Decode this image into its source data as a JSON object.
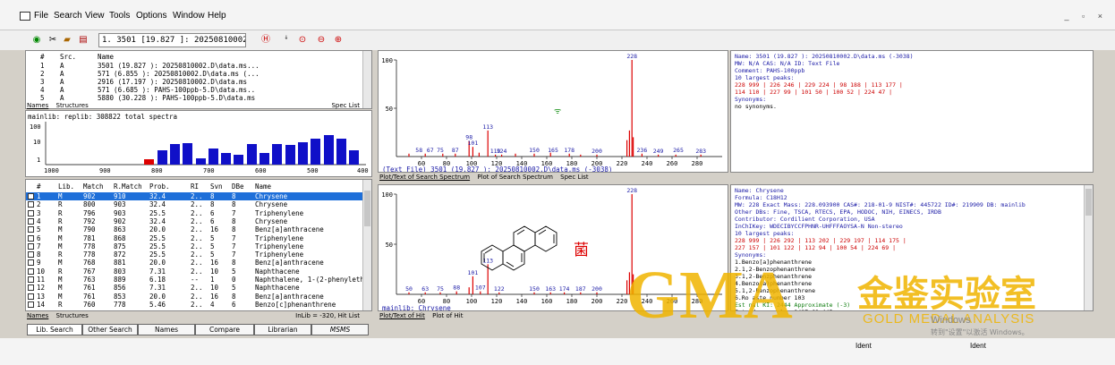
{
  "menu": {
    "items": [
      "File",
      "Search",
      "View",
      "Tools",
      "Options",
      "Window",
      "Help"
    ],
    "window_controls": "_ ▫ ×"
  },
  "toolbar": {
    "hit_select": "1. 3501 [19.827 ]: 20250810002.D\\c"
  },
  "hitlist_top": {
    "headers": [
      "#",
      "Src.",
      "Name"
    ],
    "rows": [
      {
        "n": "1",
        "src": "A",
        "name": "3501 (19.827 ): 20250810002.D\\data.ms..."
      },
      {
        "n": "2",
        "src": "A",
        "name": "571 (6.855 ): 20250810002.D\\data.ms (..."
      },
      {
        "n": "3",
        "src": "A",
        "name": "2916 (17.197 ): 20250810002.D\\data.ms"
      },
      {
        "n": "4",
        "src": "A",
        "name": "571 (6.685 ): PAHS-100ppb-5.D\\data.ms.."
      },
      {
        "n": "5",
        "src": "A",
        "name": "5880 (30.228 ): PAHS-100ppb-5.D\\data.ms"
      }
    ],
    "tabs": [
      "Names",
      "Structures"
    ],
    "label": "Spec List"
  },
  "histogram": {
    "caption": "mainlib: replib: 308822 total spectra",
    "y_ticks": [
      "100",
      "10",
      "1"
    ],
    "x_ticks": [
      "1000",
      "900",
      "800",
      "700",
      "600",
      "500",
      "400"
    ]
  },
  "hitlist": {
    "headers": [
      "#",
      "Lib.",
      "Match",
      "R.Match",
      "Prob.",
      "RI",
      "Svn",
      "DBe",
      "Name"
    ],
    "rows": [
      {
        "n": "1",
        "lib": "M",
        "match": "902",
        "rmatch": "910",
        "prob": "32.4",
        "ri": "2..",
        "svn": "8",
        "dbe": "8",
        "name": "Chrysene"
      },
      {
        "n": "2",
        "lib": "R",
        "match": "800",
        "rmatch": "903",
        "prob": "32.4",
        "ri": "2..",
        "svn": "8",
        "dbe": "8",
        "name": "Chrysene"
      },
      {
        "n": "3",
        "lib": "R",
        "match": "796",
        "rmatch": "903",
        "prob": "25.5",
        "ri": "2..",
        "svn": "6",
        "dbe": "7",
        "name": "Triphenylene"
      },
      {
        "n": "4",
        "lib": "R",
        "match": "792",
        "rmatch": "902",
        "prob": "32.4",
        "ri": "2..",
        "svn": "6",
        "dbe": "8",
        "name": "Chrysene"
      },
      {
        "n": "5",
        "lib": "M",
        "match": "790",
        "rmatch": "863",
        "prob": "20.0",
        "ri": "2..",
        "svn": "16",
        "dbe": "8",
        "name": "Benz[a]anthracene"
      },
      {
        "n": "6",
        "lib": "M",
        "match": "781",
        "rmatch": "868",
        "prob": "25.5",
        "ri": "2..",
        "svn": "5",
        "dbe": "7",
        "name": "Triphenylene"
      },
      {
        "n": "7",
        "lib": "M",
        "match": "778",
        "rmatch": "875",
        "prob": "25.5",
        "ri": "2..",
        "svn": "5",
        "dbe": "7",
        "name": "Triphenylene"
      },
      {
        "n": "8",
        "lib": "R",
        "match": "778",
        "rmatch": "872",
        "prob": "25.5",
        "ri": "2..",
        "svn": "5",
        "dbe": "7",
        "name": "Triphenylene"
      },
      {
        "n": "9",
        "lib": "M",
        "match": "768",
        "rmatch": "881",
        "prob": "20.0",
        "ri": "2..",
        "svn": "16",
        "dbe": "8",
        "name": "Benz[a]anthracene"
      },
      {
        "n": "10",
        "lib": "R",
        "match": "767",
        "rmatch": "803",
        "prob": "7.31",
        "ri": "2..",
        "svn": "10",
        "dbe": "5",
        "name": "Naphthacene"
      },
      {
        "n": "11",
        "lib": "M",
        "match": "763",
        "rmatch": "889",
        "prob": "6.18",
        "ri": "--",
        "svn": "1",
        "dbe": "0",
        "name": "Naphthalene, 1-(2-phenyleth"
      },
      {
        "n": "12",
        "lib": "M",
        "match": "761",
        "rmatch": "856",
        "prob": "7.31",
        "ri": "2..",
        "svn": "10",
        "dbe": "5",
        "name": "Naphthacene"
      },
      {
        "n": "13",
        "lib": "M",
        "match": "761",
        "rmatch": "853",
        "prob": "20.0",
        "ri": "2..",
        "svn": "16",
        "dbe": "8",
        "name": "Benz[a]anthracene"
      },
      {
        "n": "14",
        "lib": "R",
        "match": "760",
        "rmatch": "778",
        "prob": "5.46",
        "ri": "2..",
        "svn": "4",
        "dbe": "6",
        "name": "Benzo[c]phenanthrene"
      }
    ],
    "tabs": [
      "Names",
      "Structures"
    ],
    "label": "InLib = -320, Hit List"
  },
  "bottom_tabs": [
    "Lib. Search",
    "Other Search",
    "Names",
    "Compare",
    "Librarian",
    "MSMS"
  ],
  "spectrum_top": {
    "caption": "(Text File) 3501 (19.827 ): 20250810002.D\\data.ms (-3038)",
    "tabs": [
      "Plot/Text of Search Spectrum",
      "Plot of Search Spectrum",
      "Spec List"
    ]
  },
  "spectrum_bottom": {
    "caption": "mainlib: Chrysene",
    "tabs": [
      "Plot/Text of Hit",
      "Plot of Hit"
    ],
    "compound_label": "菌"
  },
  "chart_data": [
    {
      "type": "bar",
      "title": "(Text File) 3501 (19.827 ): 20250810002.D\\data.ms (-3038)",
      "xlabel": "",
      "ylabel": "",
      "xlim": [
        40,
        300
      ],
      "ylim": [
        0,
        100
      ],
      "x_ticks": [
        "60",
        "80",
        "100",
        "120",
        "140",
        "160",
        "180",
        "200",
        "220",
        "240",
        "260",
        "280"
      ],
      "y_ticks": [
        "100",
        "50"
      ],
      "x": [
        50,
        63,
        77,
        87,
        98,
        101,
        106,
        113,
        119,
        124,
        135,
        150,
        163,
        178,
        187,
        200,
        224,
        226,
        228,
        229,
        236,
        249,
        263,
        283
      ],
      "values": [
        3,
        3,
        3,
        3,
        16,
        10,
        4,
        27,
        2,
        2,
        3,
        3,
        4,
        3,
        2,
        2,
        17,
        27,
        100,
        20,
        3,
        2,
        2,
        2
      ],
      "peak_labels": [
        {
          "x": 58,
          "text": "58"
        },
        {
          "x": 67,
          "text": "67"
        },
        {
          "x": 75,
          "text": "75"
        },
        {
          "x": 87,
          "text": "87"
        },
        {
          "x": 98,
          "text": "98"
        },
        {
          "x": 101,
          "text": "101"
        },
        {
          "x": 113,
          "text": "113"
        },
        {
          "x": 119,
          "text": "119"
        },
        {
          "x": 124,
          "text": "124"
        },
        {
          "x": 150,
          "text": "150"
        },
        {
          "x": 165,
          "text": "165"
        },
        {
          "x": 178,
          "text": "178"
        },
        {
          "x": 200,
          "text": "200"
        },
        {
          "x": 228,
          "text": "228"
        },
        {
          "x": 236,
          "text": "236"
        },
        {
          "x": 249,
          "text": "249"
        },
        {
          "x": 265,
          "text": "265"
        },
        {
          "x": 283,
          "text": "283"
        }
      ]
    },
    {
      "type": "bar",
      "title": "mainlib: Chrysene",
      "xlabel": "",
      "ylabel": "",
      "xlim": [
        40,
        300
      ],
      "ylim": [
        0,
        100
      ],
      "x_ticks": [
        "60",
        "80",
        "100",
        "120",
        "140",
        "160",
        "180",
        "200",
        "220",
        "240",
        "260",
        "280"
      ],
      "y_ticks": [
        "100",
        "50"
      ],
      "x": [
        50,
        63,
        75,
        88,
        98,
        101,
        107,
        113,
        122,
        150,
        163,
        174,
        187,
        200,
        224,
        226,
        228,
        229
      ],
      "values": [
        2,
        2,
        2,
        3,
        7,
        18,
        3,
        30,
        2,
        2,
        2,
        2,
        2,
        2,
        14,
        22,
        100,
        20
      ],
      "peak_labels": [
        {
          "x": 50,
          "text": "50"
        },
        {
          "x": 63,
          "text": "63"
        },
        {
          "x": 75,
          "text": "75"
        },
        {
          "x": 88,
          "text": "88"
        },
        {
          "x": 101,
          "text": "101"
        },
        {
          "x": 107,
          "text": "107"
        },
        {
          "x": 113,
          "text": "113"
        },
        {
          "x": 122,
          "text": "122"
        },
        {
          "x": 150,
          "text": "150"
        },
        {
          "x": 163,
          "text": "163"
        },
        {
          "x": 174,
          "text": "174"
        },
        {
          "x": 187,
          "text": "187"
        },
        {
          "x": 200,
          "text": "200"
        },
        {
          "x": 228,
          "text": "228"
        }
      ]
    }
  ],
  "info_top": [
    {
      "t": "Name: 3501 (19.827 ): 20250810002.D\\data.ms (-3038)",
      "c": "blu"
    },
    {
      "t": "MW:  N/A  CAS:  N/A  ID: Text File",
      "c": "blu"
    },
    {
      "t": "Comment: PAHS-100ppb",
      "c": "blu"
    },
    {
      "t": "10 largest peaks:",
      "c": "blu"
    },
    {
      "t": "  228 999 |  226 246 |  229 224 |   98 188 |  113 177 |",
      "c": "red"
    },
    {
      "t": "  114 110 |  227  99 |  101  50 |  100  52 |  224  47 |",
      "c": "red"
    },
    {
      "t": "Synonyms:",
      "c": "blu"
    },
    {
      "t": "no synonyms.",
      "c": ""
    }
  ],
  "info_bottom": [
    {
      "t": "Name: Chrysene",
      "c": "blu"
    },
    {
      "t": "Formula: C18H12",
      "c": "blu"
    },
    {
      "t": "MW: 228 Exact Mass: 228.093900 CAS#: 218-01-9 NIST#: 445722 ID#: 219909 DB: mainlib",
      "c": "blu"
    },
    {
      "t": "Other DBs: Fine, TSCA, RTECS, EPA, HODOC, NIH, EINECS, IRDB",
      "c": "blu"
    },
    {
      "t": "Contributor: Cordilient Corporation, USA",
      "c": "blu"
    },
    {
      "t": "InChIKey: WDECIBYCCFPHNR-UHFFFAOYSA-N  Non-stereo",
      "c": "blu"
    },
    {
      "t": "10 largest peaks:",
      "c": "blu"
    },
    {
      "t": "  228 999 |  226 292 |  113 202 |  229 197 |  114 175 |",
      "c": "red"
    },
    {
      "t": "  227 157 |  101 122 |  112  94 |  100  54 |  224  69 |",
      "c": "red"
    },
    {
      "t": "Synonyms:",
      "c": "blu"
    },
    {
      "t": "1.Benzo[a]phenanthrene",
      "c": ""
    },
    {
      "t": "2.1,2-Benzophenanthrene",
      "c": ""
    },
    {
      "t": "3.1,2-Benzphenanthrene",
      "c": ""
    },
    {
      "t": "4.Benzo(a)phenanthrene",
      "c": ""
    },
    {
      "t": "5.1,2-Benzophenanthrene",
      "c": ""
    },
    {
      "t": "6.Ro  aste number 103",
      "c": ""
    },
    {
      "t": "Est  nal KI: 2444 Approximate (-3)",
      "c": "grn"
    },
    {
      "t": "Est  rd non-polar  2427±68 (45",
      "c": ""
    },
    {
      "t": "Est  semi-polar    2449±39 (21",
      "c": ""
    },
    {
      "t": "Kovats  polar        3468±72 (12",
      "c": ""
    }
  ],
  "watermark": {
    "brand": "GMA",
    "cn": "金鉴实验室",
    "en": "GOLD MEDAL ANALYSIS",
    "os1": "Windows",
    "os2": "转到\"设置\"以激活 Windows。"
  },
  "status": {
    "ident1": "Ident",
    "ident2": "Ident"
  }
}
